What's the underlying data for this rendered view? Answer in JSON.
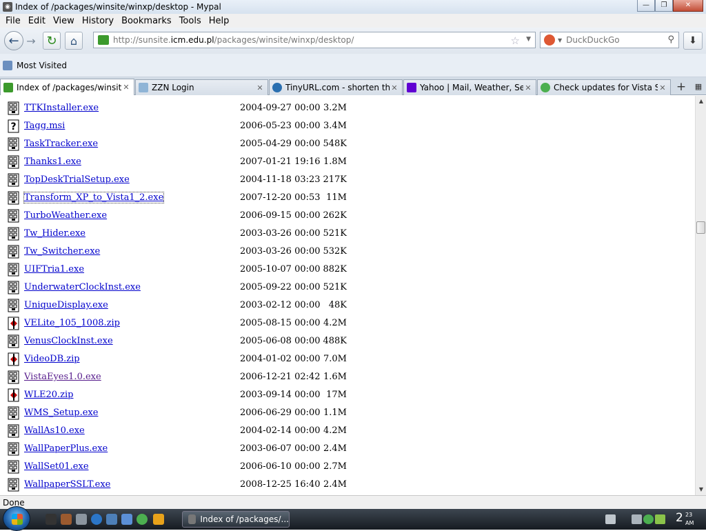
{
  "window": {
    "title": "Index of /packages/winsite/winxp/desktop - Mypal",
    "minimize_icon": "minimize-icon",
    "maximize_icon": "restore-icon",
    "close_icon": "close-icon"
  },
  "menu": [
    "File",
    "Edit",
    "View",
    "History",
    "Bookmarks",
    "Tools",
    "Help"
  ],
  "nav": {
    "url_prefix": "http://sunsite.",
    "url_host": "icm.edu.pl",
    "url_path": "/packages/winsite/winxp/desktop/",
    "search_placeholder": "DuckDuckGo"
  },
  "bookmarks": {
    "most_visited": "Most Visited"
  },
  "tabs": [
    {
      "label": "Index of /packages/winsite...",
      "active": true,
      "color": "#3c9a2c"
    },
    {
      "label": "ZZN Login",
      "active": false,
      "color": "#8fb4d6"
    },
    {
      "label": "TinyURL.com - shorten tha...",
      "active": false,
      "color": "#2a6fb0"
    },
    {
      "label": "Yahoo | Mail, Weather, Sea...",
      "active": false,
      "color": "#6001d2"
    },
    {
      "label": "Check updates for Vista St...",
      "active": false,
      "color": "#4caf50"
    }
  ],
  "files": [
    {
      "name": "TTKInstaller.exe",
      "date": "2004-09-27 00:00",
      "size": "3.2M",
      "type": "exe"
    },
    {
      "name": "Tagg.msi",
      "date": "2006-05-23 00:00",
      "size": "3.4M",
      "type": "unknown"
    },
    {
      "name": "TaskTracker.exe",
      "date": "2005-04-29 00:00",
      "size": "548K",
      "type": "exe"
    },
    {
      "name": "Thanks1.exe",
      "date": "2007-01-21 19:16",
      "size": "1.8M",
      "type": "exe"
    },
    {
      "name": "TopDeskTrialSetup.exe",
      "date": "2004-11-18 03:23",
      "size": "217K",
      "type": "exe"
    },
    {
      "name": "Transform_XP_to_Vista1_2.exe",
      "date": "2007-12-20 00:53",
      "size": " 11M",
      "type": "exe",
      "focused": true
    },
    {
      "name": "TurboWeather.exe",
      "date": "2006-09-15 00:00",
      "size": "262K",
      "type": "exe"
    },
    {
      "name": "Tw_Hider.exe",
      "date": "2003-03-26 00:00",
      "size": "521K",
      "type": "exe"
    },
    {
      "name": "Tw_Switcher.exe",
      "date": "2003-03-26 00:00",
      "size": "532K",
      "type": "exe"
    },
    {
      "name": "UIFTria1.exe",
      "date": "2005-10-07 00:00",
      "size": "882K",
      "type": "exe"
    },
    {
      "name": "UnderwaterClockInst.exe",
      "date": "2005-09-22 00:00",
      "size": "521K",
      "type": "exe"
    },
    {
      "name": "UniqueDisplay.exe",
      "date": "2003-02-12 00:00",
      "size": " 48K",
      "type": "exe"
    },
    {
      "name": "VELite_105_1008.zip",
      "date": "2005-08-15 00:00",
      "size": "4.2M",
      "type": "zip"
    },
    {
      "name": "VenusClockInst.exe",
      "date": "2005-06-08 00:00",
      "size": "488K",
      "type": "exe"
    },
    {
      "name": "VideoDB.zip",
      "date": "2004-01-02 00:00",
      "size": "7.0M",
      "type": "zip"
    },
    {
      "name": "VistaEyes1.0.exe",
      "date": "2006-12-21 02:42",
      "size": "1.6M",
      "type": "exe",
      "visited": true
    },
    {
      "name": "WLE20.zip",
      "date": "2003-09-14 00:00",
      "size": " 17M",
      "type": "zip"
    },
    {
      "name": "WMS_Setup.exe",
      "date": "2006-06-29 00:00",
      "size": "1.1M",
      "type": "exe"
    },
    {
      "name": "WallAs10.exe",
      "date": "2004-02-14 00:00",
      "size": "4.2M",
      "type": "exe"
    },
    {
      "name": "WallPaperPlus.exe",
      "date": "2003-06-07 00:00",
      "size": "2.4M",
      "type": "exe"
    },
    {
      "name": "WallSet01.exe",
      "date": "2006-06-10 00:00",
      "size": "2.7M",
      "type": "exe"
    },
    {
      "name": "WallpaperSSLT.exe",
      "date": "2008-12-25 16:40",
      "size": "2.4M",
      "type": "exe"
    }
  ],
  "status": "Done",
  "taskbar": {
    "active_window": "Index of /packages/...",
    "clock_hour": "2",
    "clock_minutes": "23",
    "clock_ampm": "AM"
  }
}
